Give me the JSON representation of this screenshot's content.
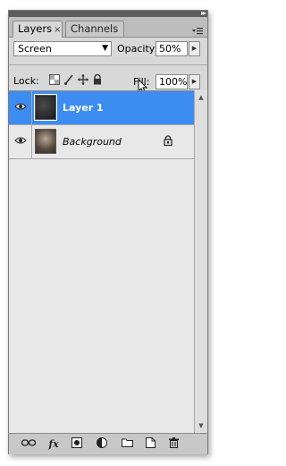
{
  "tabs": [
    {
      "label": "Layers",
      "close": "×",
      "active": true
    },
    {
      "label": "Channels",
      "active": false
    }
  ],
  "blend_mode": {
    "value": "Screen",
    "options": [
      "Screen"
    ]
  },
  "opacity": {
    "label": "Opacity:",
    "value": "50%"
  },
  "lock": {
    "label": "Lock:",
    "icons": [
      "lock-transparent-icon",
      "lock-brush-icon",
      "lock-move-icon",
      "lock-all-icon"
    ]
  },
  "fill": {
    "label": "Fill:",
    "value": "100%"
  },
  "layers": [
    {
      "name": "Layer 1",
      "visible": true,
      "selected": true,
      "locked": false
    },
    {
      "name": "Background",
      "visible": true,
      "selected": false,
      "locked": true
    }
  ],
  "bottom_icons": [
    "link-icon",
    "fx-icon",
    "mask-icon",
    "adjustment-icon",
    "folder-icon",
    "new-layer-icon",
    "trash-icon"
  ],
  "colors": {
    "selection": "#3c8cf2",
    "panel": "#d8d8d8"
  }
}
